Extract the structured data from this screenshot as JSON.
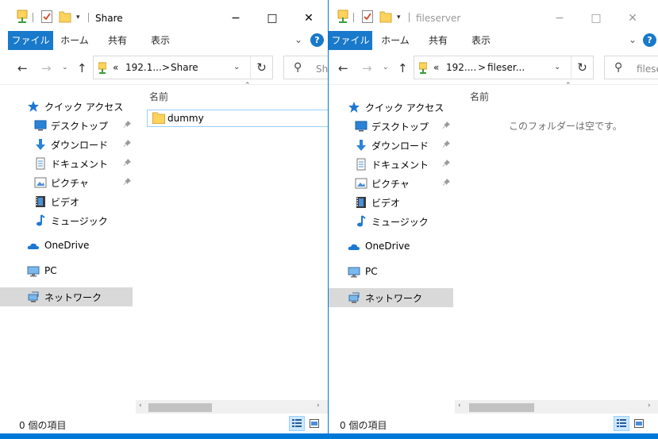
{
  "ribbon": {
    "file": "ファイル",
    "home": "ホーム",
    "share": "共有",
    "view": "表示",
    "help": "?"
  },
  "nav_labels": {
    "quick_access": "クイック アクセス",
    "desktop": "デスクトップ",
    "downloads": "ダウンロード",
    "documents": "ドキュメント",
    "pictures": "ピクチャ",
    "videos": "ビデオ",
    "music": "ミュージック",
    "onedrive": "OneDrive",
    "pc": "PC",
    "network": "ネットワーク"
  },
  "column_name": "名前",
  "status_text": "0 個の項目",
  "window1": {
    "title": "Share",
    "address": {
      "overflow": "«",
      "crumb1": "192.1...",
      "sep": ">",
      "crumb2": "Share"
    },
    "search_placeholder": "Share の検索",
    "items": [
      {
        "name": "dummy",
        "type": "folder"
      }
    ]
  },
  "window2": {
    "title": "fileserver",
    "address": {
      "overflow": "«",
      "crumb1": "192....",
      "sep": ">",
      "crumb2": "fileser..."
    },
    "search_placeholder": "fileserver の検索",
    "empty_message": "このフォルダーは空です。"
  },
  "colors": {
    "accent": "#0078d7",
    "ribbon_file_tab": "#1979ca",
    "selected_nav": "#d9d9d9",
    "selection_border": "#99d1ff",
    "folder": "#ffd35c"
  },
  "icons": {
    "minimize": "−",
    "maximize": "□",
    "close": "✕",
    "back": "←",
    "forward": "→",
    "up": "↑",
    "refresh": "↻",
    "search": "⚲",
    "dropdown": "⌄",
    "chevron_up": "⌃",
    "scroll_left": "‹",
    "scroll_right": "›"
  }
}
